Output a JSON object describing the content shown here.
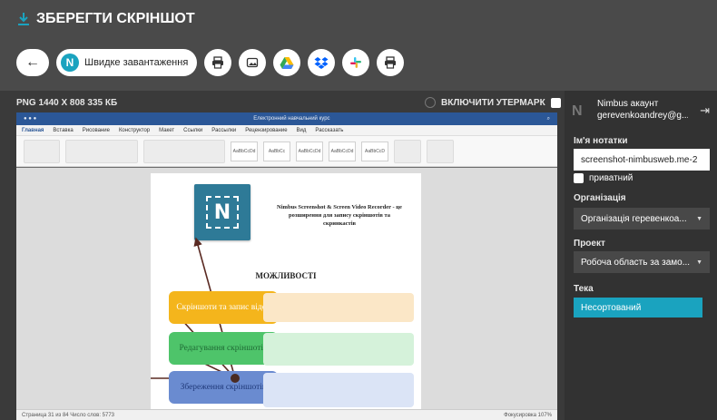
{
  "header": {
    "title": "ЗБЕРЕГТИ СКРІНШОТ",
    "quick_upload": "Швидке завантаження",
    "quick_upload_badge": "N"
  },
  "info": {
    "image_meta": "PNG 1440 X 808 335 КБ",
    "watermark_label": "ВКЛЮЧИТИ УТЕРМАРК"
  },
  "preview": {
    "window_title": "Електронний навчальний курс",
    "tabs": [
      "Главная",
      "Вставка",
      "Рисование",
      "Конструктор",
      "Макет",
      "Ссылки",
      "Рассылки",
      "Рецензирование",
      "Вид",
      "Рассказать"
    ],
    "heading": "Nimbus Screenshot & Screen Video Recorder - це розширення для запису скріншотів та скринкастів",
    "features_title": "МОЖЛИВОСТІ",
    "feature1": "Скріншоти та запис відео",
    "feature2": "Редагування скріншотів",
    "feature3": "Збереження скріншотів",
    "status_left": "Страница 31 из 84   Число слов: 5773",
    "status_right": "Фокусировка   107%"
  },
  "panel": {
    "account_title": "Nimbus акаунт",
    "account_email": "gerevenkoandrey@g...",
    "note_name_label": "Ім'я нотатки",
    "note_name_value": "screenshot-nimbusweb.me-2",
    "private_label": "приватний",
    "org_label": "Організація",
    "org_value": "Організація геревенкоа...",
    "project_label": "Проект",
    "project_value": "Робоча область за замо...",
    "folder_label": "Тека",
    "folder_value": "Несортований"
  },
  "colors": {
    "accent": "#1aa3bf",
    "topbar": "#4a4a4a",
    "panel": "#323232"
  }
}
